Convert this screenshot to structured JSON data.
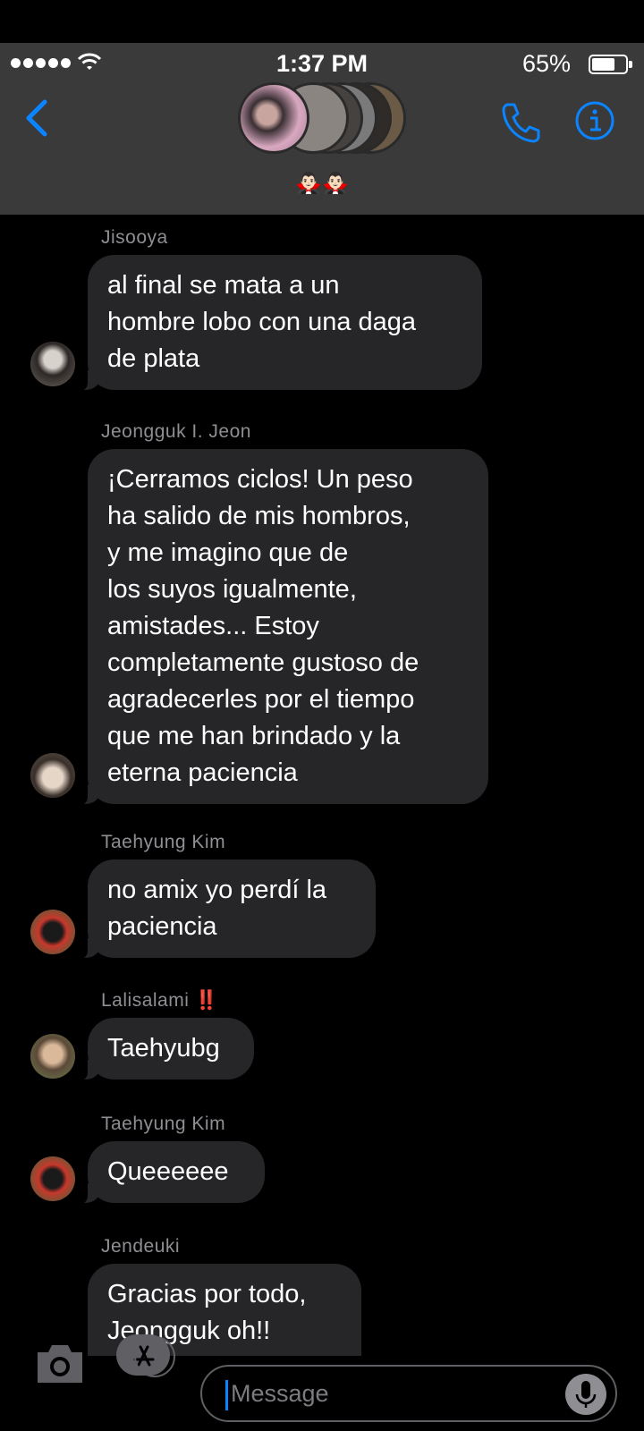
{
  "status_bar": {
    "time": "1:37 PM",
    "battery": "65%",
    "battery_level": 0.65
  },
  "header": {
    "group_label": "🧛🏻‍♂️🧛🏻‍♂️"
  },
  "messages": [
    {
      "sender": "Jisooya",
      "text": "al final se mata a un\nhombre lobo con una daga\nde plata"
    },
    {
      "sender": "Jeongguk I. Jeon",
      "text": "¡Cerramos ciclos! Un peso\nha salido de mis hombros,\ny me imagino que de\nlos suyos igualmente,\namistades... Estoy\ncompletamente gustoso de\nagradecerles por el tiempo\nque me han brindado y la\neterna paciencia"
    },
    {
      "sender": "Taehyung Kim",
      "text": "no amix yo perdí la\npaciencia"
    },
    {
      "sender": "Lalisalami",
      "sender_mark": "‼️",
      "text": "Taehyubg"
    },
    {
      "sender": "Taehyung Kim",
      "text": "Queeeeee"
    },
    {
      "sender": "Jendeuki",
      "text": "Gracias por todo,\nJeongguk oh!!"
    }
  ],
  "input": {
    "placeholder": "Message"
  },
  "colors": {
    "accent": "#0a84ff",
    "bubble": "#262629",
    "header_bg": "#3a3a3a",
    "sender": "#8e8e93"
  }
}
